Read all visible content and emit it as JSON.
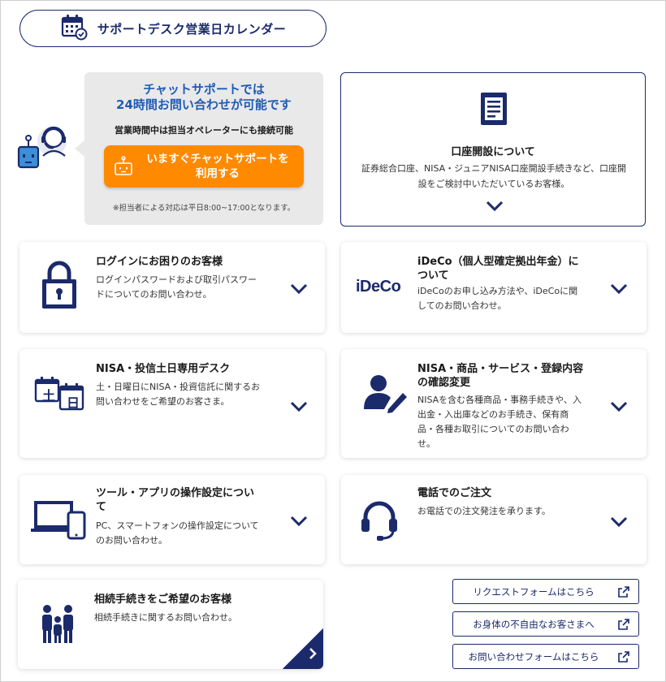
{
  "calendar_button": {
    "label": "サポートデスク営業日カレンダー",
    "icon": "calendar-check-icon"
  },
  "chat": {
    "title_line1": "チャットサポートでは",
    "title_line2": "24時間お問い合わせが可能です",
    "subtitle": "営業時間中は担当オペレーターにも接続可能",
    "cta_line1": "いますぐチャットサポートを",
    "cta_line2": "利用する",
    "note": "※担当者による対応は平日8:00~17:00となります。"
  },
  "account_open": {
    "title": "口座開設について",
    "desc_line1": "証券総合口座、NISA・ジュニアNISA口座開設手続きなど、口座開",
    "desc_line2": "設をご検討中いただいているお客様。"
  },
  "cards": {
    "login": {
      "title": "ログインにお困りのお客様",
      "desc_line1": "ログインパスワードおよび取引パスワー",
      "desc_line2": "ドについてのお問い合わせ。"
    },
    "ideco": {
      "logo": "iDeCo",
      "title_line1": "iDeCo（個人型確定拠出年金）に",
      "title_line2": "ついて",
      "desc_line1": "iDeCoのお申し込み方法や、iDeCoに関",
      "desc_line2": "してのお問い合わせ。"
    },
    "nisa_weekend": {
      "title": "NISA・投信土日専用デスク",
      "desc_line1": "土・日曜日にNISA・投資信託に関するお",
      "desc_line2": "問い合わせをご希望のお客さま。",
      "icon_char1": "土",
      "icon_char2": "日"
    },
    "nisa_products": {
      "title_line1": "NISA・商品・サービス・登録内容",
      "title_line2": "の確認変更",
      "desc_line1": "NISAを含む各種商品・事務手続きや、入",
      "desc_line2": "出金・入出庫などのお手続き、保有商",
      "desc_line3": "品・各種お取引についてのお問い合わ",
      "desc_line4": "せ。"
    },
    "tools": {
      "title_line1": "ツール・アプリの操作設定につい",
      "title_line2": "て",
      "desc_line1": "PC、スマートフォンの操作設定について",
      "desc_line2": "のお問い合わせ。"
    },
    "phone": {
      "title": "電話でのご注文",
      "desc": "お電話での注文発注を承ります。"
    },
    "inheritance": {
      "title": "相続手続きをご希望のお客様",
      "desc": "相続手続きに関するお問い合わせ。"
    }
  },
  "links": [
    {
      "label": "リクエストフォームはこちら"
    },
    {
      "label": "お身体の不自由なお客さまへ"
    },
    {
      "label": "お問い合わせフォームはこちら"
    }
  ],
  "colors": {
    "navy": "#1b2a6b",
    "orange": "#ff8a00",
    "chat_blue": "#1f5bb5",
    "chat_bg": "#e9e9e9"
  }
}
